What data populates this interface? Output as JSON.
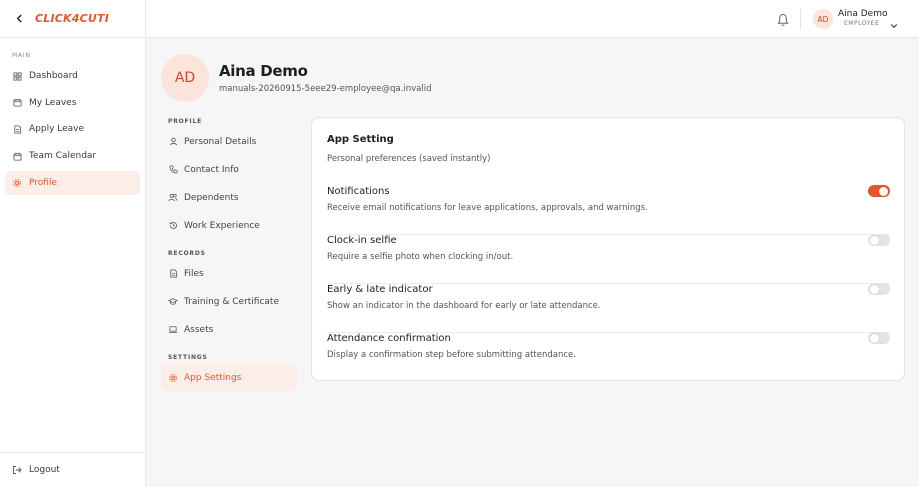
{
  "brand": {
    "logo_text": "CLICK4CUTI"
  },
  "sidebar": {
    "section": "MAIN",
    "items": [
      {
        "label": "Dashboard",
        "icon": "dashboard-icon"
      },
      {
        "label": "My Leaves",
        "icon": "calendar-icon"
      },
      {
        "label": "Apply Leave",
        "icon": "document-icon"
      },
      {
        "label": "Team Calendar",
        "icon": "calendar-icon"
      },
      {
        "label": "Profile",
        "icon": "gear-icon",
        "active": true
      }
    ],
    "logout": "Logout"
  },
  "topbar": {
    "avatar_initials": "AD",
    "user_name": "Aina Demo",
    "user_role": "EMPLOYEE"
  },
  "profile": {
    "initials": "AD",
    "name": "Aina Demo",
    "email": "manuals-20260915-5eee29-employee@qa.invalid"
  },
  "subnav": {
    "profile_section": "PROFILE",
    "profile_items": [
      "Personal Details",
      "Contact Info",
      "Dependents",
      "Work Experience"
    ],
    "records_section": "RECORDS",
    "records_items": [
      "Files",
      "Training & Certificate",
      "Assets"
    ],
    "settings_section": "SETTINGS",
    "settings_items": [
      "App Settings"
    ]
  },
  "card": {
    "title": "App Setting",
    "subtitle": "Personal preferences (saved instantly)",
    "settings": [
      {
        "title": "Notifications",
        "description": "Receive email notifications for leave applications, approvals, and warnings.",
        "enabled": true
      },
      {
        "title": "Clock-in selfie",
        "description": "Require a selfie photo when clocking in/out.",
        "enabled": false
      },
      {
        "title": "Early & late indicator",
        "description": "Show an indicator in the dashboard for early or late attendance.",
        "enabled": false
      },
      {
        "title": "Attendance confirmation",
        "description": "Display a confirmation step before submitting attendance.",
        "enabled": false
      }
    ]
  },
  "colors": {
    "accent": "#e4572e",
    "accent_soft": "#fbeee8",
    "toggle_off": "#e3e3e3"
  }
}
